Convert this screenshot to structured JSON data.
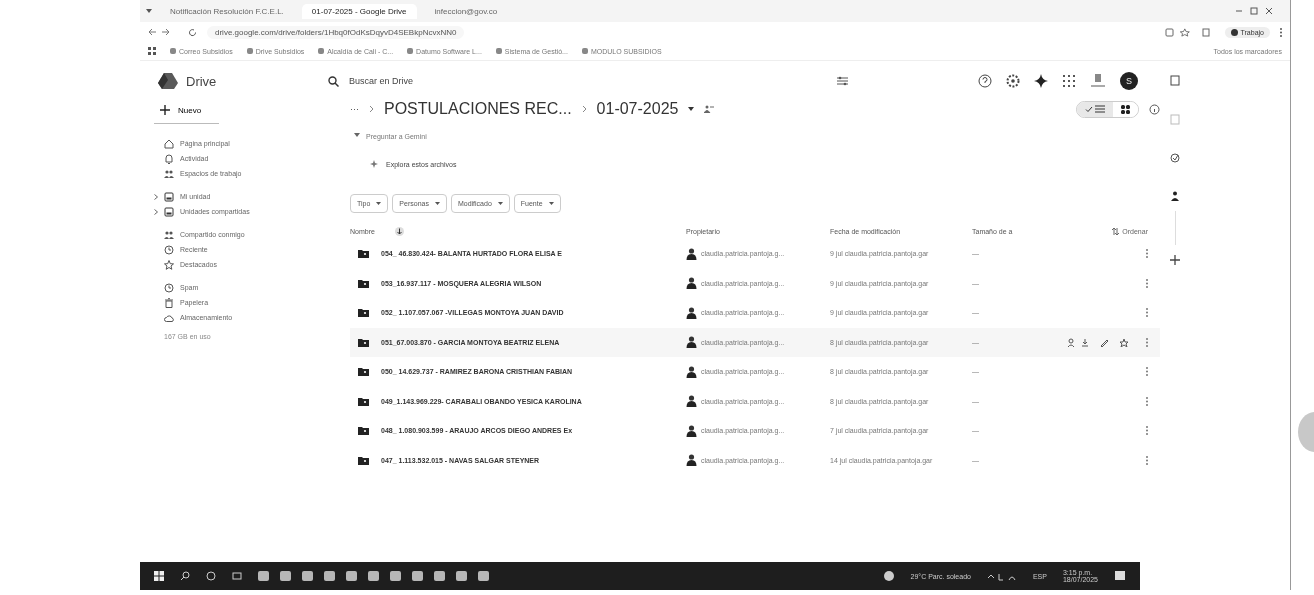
{
  "browser": {
    "tabs": [
      {
        "title": "Notificación Resolución F.C.E.L.",
        "selected": false
      },
      {
        "title": "01-07-2025 - Google Drive",
        "selected": true
      },
      {
        "title": "infeccion@gov.co",
        "selected": false
      }
    ],
    "url": "drive.google.com/drive/folders/1Hbq0fOdKsDqyvD4SEBkpNcvxNN0",
    "profile": "Trabajo",
    "bookmarks": [
      "Correo Subsidios",
      "Drive Subsidios",
      "Alcaldía de Cali - C...",
      "Datumo Software L...",
      "Sistema de Gestió...",
      "MODULO SUBSIDIOS"
    ],
    "all_bookmarks": "Todos los marcadores"
  },
  "drive": {
    "logo": "Drive",
    "search": {
      "placeholder": "Buscar en Drive"
    },
    "avatar": "S",
    "new_button": "Nuevo",
    "nav_groups": [
      [
        {
          "label": "Página principal",
          "expandable": false
        },
        {
          "label": "Actividad",
          "expandable": false
        },
        {
          "label": "Espacios de trabajo",
          "expandable": false
        }
      ],
      [
        {
          "label": "Mi unidad",
          "expandable": true
        },
        {
          "label": "Unidades compartidas",
          "expandable": true
        }
      ],
      [
        {
          "label": "Compartido conmigo",
          "expandable": false
        },
        {
          "label": "Reciente",
          "expandable": false
        },
        {
          "label": "Destacados",
          "expandable": false
        }
      ],
      [
        {
          "label": "Spam",
          "expandable": false
        },
        {
          "label": "Papelera",
          "expandable": false
        },
        {
          "label": "Almacenamiento",
          "expandable": false
        }
      ]
    ],
    "storage": "167 GB en uso",
    "breadcrumb": {
      "more": "···",
      "parent": "POSTULACIONES REC...",
      "current": "01-07-2025"
    },
    "view_modes": [
      {
        "kind": "list",
        "selected": true
      },
      {
        "kind": "grid",
        "selected": false
      }
    ],
    "gemini": "Preguntar a Gemini",
    "explore": "Explora estos archivos",
    "filters": [
      "Tipo",
      "Personas",
      "Modificado",
      "Fuente"
    ],
    "columns": {
      "name": "Nombre",
      "owner": "Propietario",
      "modified": "Fecha de modificación",
      "size": "Tamaño de a",
      "sort": "Ordenar"
    },
    "rows": [
      {
        "name": "054_ 46.830.424- BALANTA HURTADO FLORA ELISA E",
        "owner": "claudia.patricia.pantoja.g...",
        "modified": "9 jul claudia.patricia.pantoja.gar",
        "size": "—",
        "hovered": false
      },
      {
        "name": "053_16.937.117 - MOSQUERA ALEGRIA WILSON",
        "owner": "claudia.patricia.pantoja.g...",
        "modified": "9 jul claudia.patricia.pantoja.gar",
        "size": "—",
        "hovered": false
      },
      {
        "name": "052_ 1.107.057.067 -VILLEGAS MONTOYA JUAN DAVID",
        "owner": "claudia.patricia.pantoja.g...",
        "modified": "9 jul claudia.patricia.pantoja.gar",
        "size": "—",
        "hovered": false
      },
      {
        "name": "051_67.003.870 - GARCIA MONTOYA BEATRIZ ELENA",
        "owner": "claudia.patricia.pantoja.g...",
        "modified": "8 jul claudia.patricia.pantoja.gar",
        "size": "—",
        "hovered": true
      },
      {
        "name": "050_ 14.629.737 - RAMIREZ BARONA CRISTHIAN FABIAN",
        "owner": "claudia.patricia.pantoja.g...",
        "modified": "8 jul claudia.patricia.pantoja.gar",
        "size": "—",
        "hovered": false
      },
      {
        "name": "049_1.143.969.229- CARABALI OBANDO YESICA KAROLINA",
        "owner": "claudia.patricia.pantoja.g...",
        "modified": "8 jul claudia.patricia.pantoja.gar",
        "size": "—",
        "hovered": false
      },
      {
        "name": "048_ 1.080.903.599 - ARAUJO ARCOS DIEGO ANDRES Ex",
        "owner": "claudia.patricia.pantoja.g...",
        "modified": "7 jul claudia.patricia.pantoja.gar",
        "size": "—",
        "hovered": false
      },
      {
        "name": "047_ 1.113.532.015 - NAVAS SALGAR STEYNER",
        "owner": "claudia.patricia.pantoja.g...",
        "modified": "14 jul claudia.patricia.pantoja.gar",
        "size": "—",
        "hovered": false
      }
    ]
  },
  "taskbar": {
    "weather": "29°C Parc. soleado",
    "language": "ESP",
    "time": "3:15 p.m.",
    "date": "18/07/2025"
  }
}
